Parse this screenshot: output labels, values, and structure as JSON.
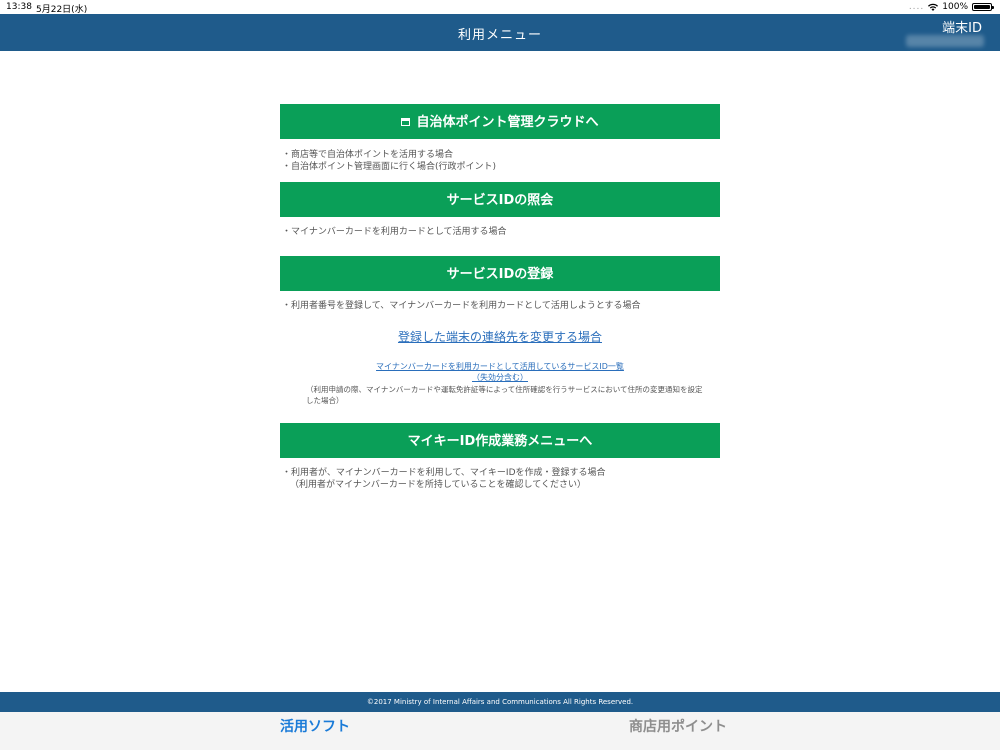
{
  "status_bar": {
    "time": "13:38",
    "date": "5月22日(水)",
    "signal": "....",
    "battery": "100%"
  },
  "header": {
    "title": "利用メニュー",
    "terminal_label": "端末ID"
  },
  "menu": {
    "cloud_button": "自治体ポイント管理クラウドへ",
    "cloud_notes": [
      "・商店等で自治体ポイントを活用する場合",
      "・自治体ポイント管理画面に行く場合(行政ポイント)"
    ],
    "service_id_inquiry_button": "サービスIDの照会",
    "service_id_inquiry_note": "・マイナンバーカードを利用カードとして活用する場合",
    "service_id_register_button": "サービスIDの登録",
    "service_id_register_note": "・利用者番号を登録して、マイナンバーカードを利用カードとして活用しようとする場合",
    "change_contact_link": "登録した端末の連絡先を変更する場合",
    "service_id_list_link_line1": "マイナンバーカードを利用カードとして活用しているサービスID一覧",
    "service_id_list_link_line2": "（失効分含む）",
    "service_id_list_note": "（利用申請の際、マイナンバーカードや運転免許証等によって住所確認を行うサービスにおいて住所の変更通知を設定した場合）",
    "mykey_button": "マイキーID作成業務メニューへ",
    "mykey_notes": [
      "・利用者が、マイナンバーカードを利用して、マイキーIDを作成・登録する場合",
      "（利用者がマイナンバーカードを所持していることを確認してください）"
    ]
  },
  "footer": {
    "copyright": "©2017 Ministry of Internal Affairs and Communications All Rights Reserved."
  },
  "tabs": [
    {
      "label": "活用ソフト"
    },
    {
      "label": "商店用ポイント"
    }
  ],
  "colors": {
    "header_bg": "#1f5b8b",
    "button_green": "#0a9f58",
    "link_blue": "#2a6ebb",
    "tab_active": "#1a7bd8"
  }
}
